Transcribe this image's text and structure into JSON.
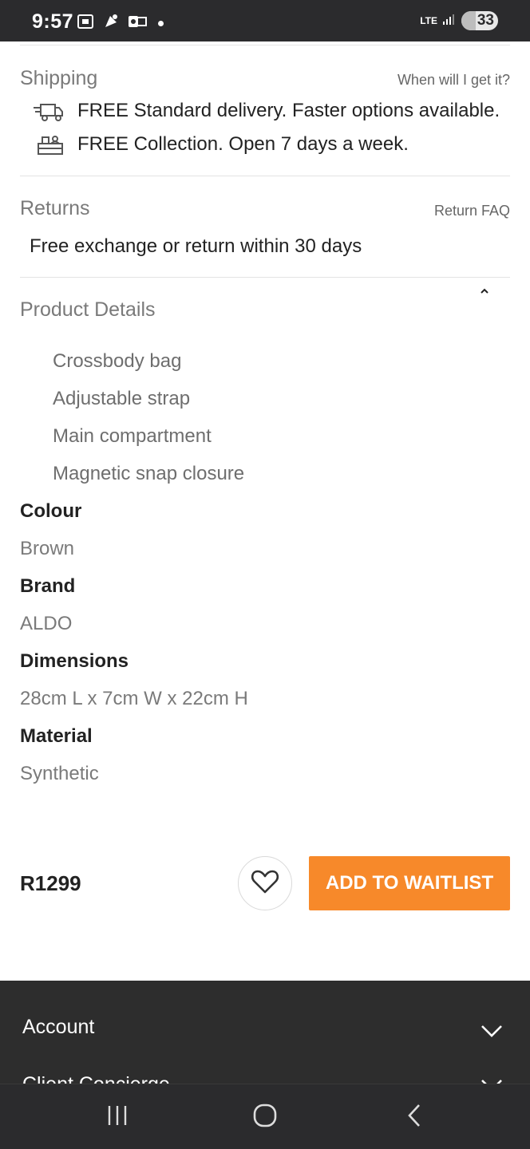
{
  "status_bar": {
    "time": "9:57",
    "network": "LTE",
    "battery": "33"
  },
  "shipping": {
    "title": "Shipping",
    "link": "When will I get it?",
    "delivery_text": "FREE Standard delivery. Faster options available.",
    "collection_text": "FREE Collection. Open 7 days a week."
  },
  "returns": {
    "title": "Returns",
    "link": "Return FAQ",
    "text": "Free exchange or return within 30 days"
  },
  "product_details": {
    "title": "Product Details",
    "items": [
      "Crossbody bag",
      "Adjustable strap",
      "Main compartment",
      "Magnetic snap closure"
    ],
    "attributes": [
      {
        "label": "Colour",
        "value": "Brown"
      },
      {
        "label": "Brand",
        "value": "ALDO"
      },
      {
        "label": "Dimensions",
        "value": "28cm L x 7cm W x 22cm H"
      },
      {
        "label": "Material",
        "value": "Synthetic"
      }
    ]
  },
  "purchase": {
    "price": "R1299",
    "waitlist_label": "ADD TO WAITLIST"
  },
  "footer": {
    "items": [
      "Account",
      "Client Concierge"
    ]
  },
  "colors": {
    "accent": "#f7892a",
    "footer_bg": "#2d2d2d",
    "status_bg": "#2b2b2d"
  }
}
